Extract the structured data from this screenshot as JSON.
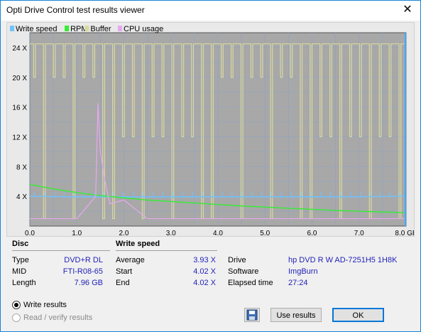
{
  "window": {
    "title": "Opti Drive Control test results viewer",
    "close_glyph": "✕"
  },
  "chart_data": {
    "type": "line",
    "legend": [
      {
        "name": "Write speed",
        "color": "#6fc3ff"
      },
      {
        "name": "RPM",
        "color": "#33ee33"
      },
      {
        "name": "Buffer",
        "color": "#d9d9a0"
      },
      {
        "name": "CPU usage",
        "color": "#e8a8f0"
      }
    ],
    "y_ticks": [
      "24 X",
      "20 X",
      "16 X",
      "12 X",
      "8 X",
      "4 X"
    ],
    "x_ticks": [
      "0.0",
      "1.0",
      "2.0",
      "3.0",
      "4.0",
      "5.0",
      "6.0",
      "7.0",
      "8.0 GB"
    ],
    "xlim": [
      0,
      8
    ],
    "ylim": [
      0,
      26
    ],
    "grid": true,
    "series": [
      {
        "name": "Write speed",
        "x": [
          0,
          0.5,
          1,
          2,
          3,
          4,
          5,
          6,
          7,
          7.96
        ],
        "y": [
          4.02,
          3.95,
          3.93,
          3.93,
          3.93,
          3.93,
          3.93,
          3.93,
          3.93,
          4.02
        ]
      },
      {
        "name": "RPM",
        "x": [
          0,
          0.5,
          1,
          1.5,
          2,
          2.5,
          3,
          3.5,
          4,
          4.5,
          5,
          5.5,
          6,
          6.5,
          7,
          7.5,
          7.96
        ],
        "y": [
          5.6,
          5.0,
          4.5,
          4.1,
          3.8,
          3.5,
          3.3,
          3.1,
          2.9,
          2.7,
          2.55,
          2.4,
          2.25,
          2.1,
          2.0,
          1.9,
          1.8
        ]
      },
      {
        "name": "Buffer",
        "x": [
          0,
          7.96
        ],
        "y": [
          24.5,
          24.5
        ]
      },
      {
        "name": "CPU usage",
        "x": [
          0,
          0.5,
          1,
          1.4,
          1.45,
          1.5,
          1.6,
          1.7,
          2.0,
          2.5,
          3,
          4,
          5,
          6,
          7,
          7.96
        ],
        "y": [
          1.0,
          1.0,
          1.0,
          4.0,
          16.5,
          10.0,
          6.0,
          3.0,
          3.5,
          1.0,
          1.0,
          1.0,
          1.0,
          1.0,
          1.0,
          1.0
        ]
      }
    ]
  },
  "disc": {
    "title": "Disc",
    "rows": [
      {
        "label": "Type",
        "value": "DVD+R DL"
      },
      {
        "label": "MID",
        "value": "FTI-R08-65"
      },
      {
        "label": "Length",
        "value": "7.96 GB"
      }
    ]
  },
  "write_speed": {
    "title": "Write speed",
    "rows": [
      {
        "label": "Average",
        "value": "3.93 X"
      },
      {
        "label": "Start",
        "value": "4.02 X"
      },
      {
        "label": "End",
        "value": "4.02 X"
      }
    ]
  },
  "drive_info": {
    "rows": [
      {
        "label": "Drive",
        "value": "hp DVD R W AD-7251H5 1H8K"
      },
      {
        "label": "Software",
        "value": "ImgBurn"
      },
      {
        "label": "Elapsed time",
        "value": "27:24"
      }
    ]
  },
  "options": {
    "write_results": "Write results",
    "read_verify_results": "Read / verify results"
  },
  "buttons": {
    "use_results": "Use results",
    "ok": "OK"
  }
}
